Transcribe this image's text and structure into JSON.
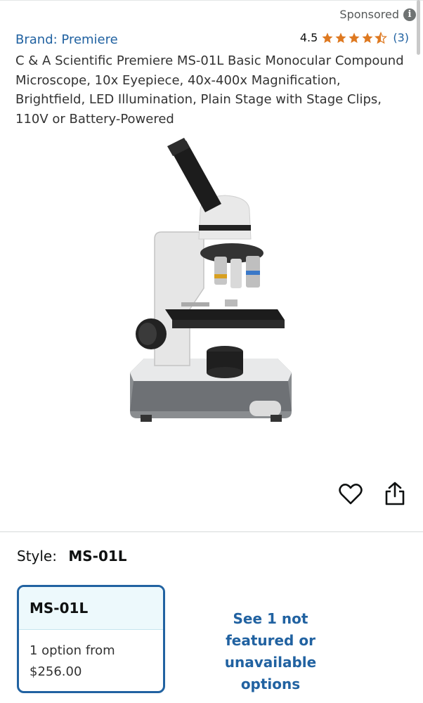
{
  "header": {
    "sponsored_label": "Sponsored",
    "info_glyph": "i"
  },
  "product": {
    "brand_link": "Brand: Premiere",
    "rating_value": "4.5",
    "rating_stars": 4.5,
    "rating_count": "(3)",
    "title": "C & A Scientific Premiere MS-01L Basic Monocular Compound Microscope, 10x Eyepiece, 40x-400x Magnification, Brightfield, LED Illumination, Plain Stage with Stage Clips, 110V or Battery-Powered",
    "image_alt": "Monocular compound microscope"
  },
  "style": {
    "label": "Style:",
    "value": "MS-01L"
  },
  "option": {
    "name": "MS-01L",
    "count_text": "1 option from",
    "price": "$256.00"
  },
  "unavailable_link": "See 1 not featured or unavailable options",
  "colors": {
    "link": "#2162a1",
    "star": "#de7921",
    "card_border": "#2162a1",
    "card_head_bg": "#edf9fc"
  },
  "icons": [
    "info-icon",
    "star-icon",
    "heart-icon",
    "share-icon"
  ]
}
